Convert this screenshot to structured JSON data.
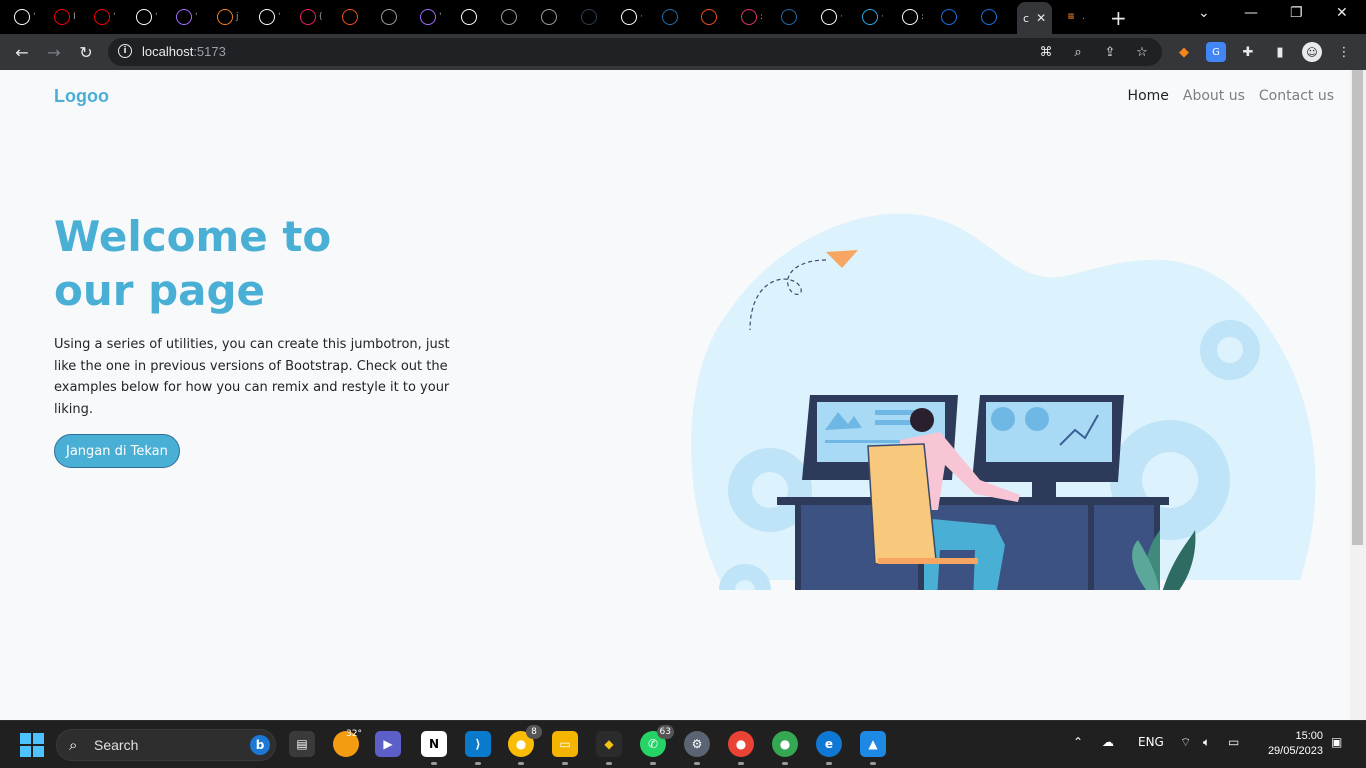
{
  "browser": {
    "tabs": [
      {
        "icon": "github-icon",
        "text": "'",
        "color": "#ffffff"
      },
      {
        "icon": "youtube-icon",
        "text": "I",
        "color": "#ff0000"
      },
      {
        "icon": "youtube-icon",
        "text": "'",
        "color": "#ff0000"
      },
      {
        "icon": "discord-icon",
        "text": "'",
        "color": "#ffffff"
      },
      {
        "icon": "vite-icon",
        "text": "'",
        "color": "#a36cff"
      },
      {
        "icon": "stackoverflow-icon",
        "text": "j",
        "color": "#f48024"
      },
      {
        "icon": "google-icon",
        "text": "'",
        "color": "#ffffff"
      },
      {
        "icon": "notification-icon",
        "text": "(",
        "color": "#e91e63"
      },
      {
        "icon": "figma-icon",
        "text": "",
        "color": "#f24e1e"
      },
      {
        "icon": "globe-icon",
        "text": "",
        "color": "#9aa0a6"
      },
      {
        "icon": "vite-icon",
        "text": "'",
        "color": "#a36cff"
      },
      {
        "icon": "cb-icon",
        "text": "",
        "color": "#ffffff"
      },
      {
        "icon": "globe-icon",
        "text": "",
        "color": "#9aa0a6"
      },
      {
        "icon": "globe-icon",
        "text": "",
        "color": "#9aa0a6"
      },
      {
        "icon": "dicoding-icon",
        "text": "",
        "color": "#2d3e50"
      },
      {
        "icon": "google-icon",
        "text": "·",
        "color": "#ffffff"
      },
      {
        "icon": "mask-icon",
        "text": "",
        "color": "#1f6fb2"
      },
      {
        "icon": "figma-icon",
        "text": "",
        "color": "#f24e1e"
      },
      {
        "icon": "instagram-icon",
        "text": ":",
        "color": "#e1306c"
      },
      {
        "icon": "mask-icon",
        "text": "",
        "color": "#1f6fb2"
      },
      {
        "icon": "google-icon",
        "text": "·",
        "color": "#ffffff"
      },
      {
        "icon": "telegram-icon",
        "text": "·",
        "color": "#29a9eb"
      },
      {
        "icon": "github-icon",
        "text": ":",
        "color": "#ffffff"
      },
      {
        "icon": "refresh-app-icon",
        "text": "",
        "color": "#1a73e8"
      },
      {
        "icon": "link-icon",
        "text": "",
        "color": "#1a73e8"
      }
    ],
    "active_tab": {
      "text": "c"
    },
    "last_tab": {
      "icon": "stackoverflow-icon",
      "text": "."
    },
    "url_host": "localhost",
    "url_port": ":5173"
  },
  "page": {
    "logo": "Logoo",
    "nav": {
      "home": "Home",
      "about": "About us",
      "contact": "Contact us"
    },
    "hero": {
      "title_line1": "Welcome to",
      "title_line2": "our page",
      "text": "Using a series of utilities, you can create this jumbotron, just like the one in previous versions of Bootstrap. Check out the examples below for how you can remix and restyle it to your liking.",
      "button": "Jangan di Tekan"
    },
    "colors": {
      "accent": "#4aafd5",
      "text": "#212529",
      "muted": "#7a7f84",
      "background": "#f8f9fa"
    }
  },
  "taskbar": {
    "search_label": "Search",
    "weather_temp": "32°",
    "whatsapp_badge": "63",
    "chrome_badge": "8",
    "language": "ENG",
    "time": "15:00",
    "date": "29/05/2023"
  }
}
